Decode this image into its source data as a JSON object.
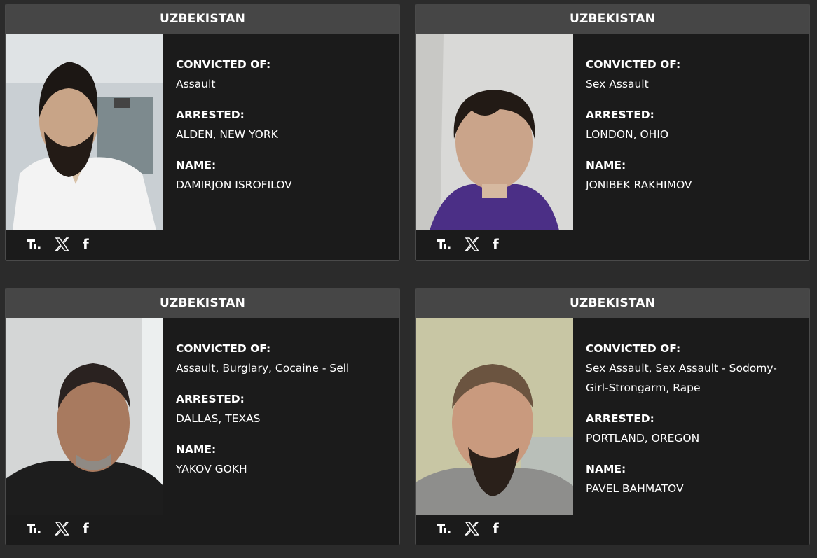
{
  "cards": [
    {
      "country": "UZBEKISTAN",
      "convicted_label": "CONVICTED OF:",
      "convicted": "Assault",
      "arrested_label": "ARRESTED:",
      "arrested": "ALDEN, NEW YORK",
      "name_label": "NAME:",
      "name": "DAMIRJON ISROFILOV"
    },
    {
      "country": "UZBEKISTAN",
      "convicted_label": "CONVICTED OF:",
      "convicted": "Sex Assault",
      "arrested_label": "ARRESTED:",
      "arrested": "LONDON, OHIO",
      "name_label": "NAME:",
      "name": "JONIBEK RAKHIMOV"
    },
    {
      "country": "UZBEKISTAN",
      "convicted_label": "CONVICTED OF:",
      "convicted": "Assault, Burglary, Cocaine - Sell",
      "arrested_label": "ARRESTED:",
      "arrested": "DALLAS, TEXAS",
      "name_label": "NAME:",
      "name": "YAKOV GOKH"
    },
    {
      "country": "UZBEKISTAN",
      "convicted_label": "CONVICTED OF:",
      "convicted": "Sex Assault, Sex Assault - Sodomy-Girl-Strongarm, Rape",
      "arrested_label": "ARRESTED:",
      "arrested": "PORTLAND, OREGON",
      "name_label": "NAME:",
      "name": "PAVEL BAHMATOV"
    }
  ],
  "share_icons": [
    "truth-social-icon",
    "x-icon",
    "facebook-icon"
  ],
  "facebook_glyph": "f",
  "colors": {
    "page_bg": "#2b2b2b",
    "card_bg": "#1b1b1b",
    "header_bg": "#464646",
    "text": "#ffffff"
  }
}
